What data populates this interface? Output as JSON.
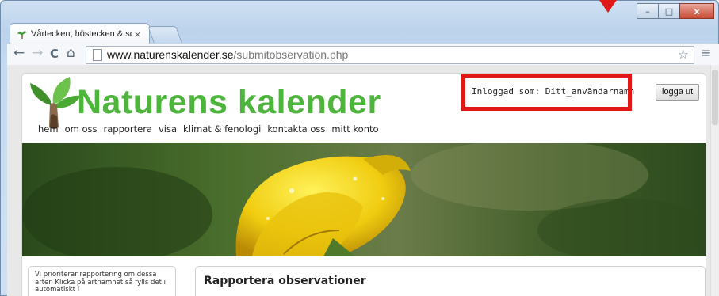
{
  "browser": {
    "tab_title": "Vårtecken, höstecken & sc",
    "tab_close": "×",
    "url_host": "www.naturenskalender.se",
    "url_path": "/submitobservation.php",
    "back": "←",
    "forward": "→",
    "reload": "C",
    "home": "⌂",
    "star": "☆",
    "menu": "≡",
    "window_minimize": "–",
    "window_maximize": "□",
    "window_close": "x"
  },
  "site": {
    "brand": "Naturens kalender",
    "nav": [
      "hem",
      "om oss",
      "rapportera",
      "visa",
      "klimat & fenologi",
      "kontakta oss",
      "mitt konto"
    ],
    "logged_in_text": "Inloggad som: Ditt_användarnamn",
    "logout_label": "logga ut",
    "sidebar_text": "Vi prioriterar rapportering om dessa arter. Klicka på artnamnet så fylls det i automatiskt i",
    "main_title": "Rapportera observationer"
  },
  "colors": {
    "brand_green": "#4db53c",
    "highlight_red": "#e01818"
  }
}
